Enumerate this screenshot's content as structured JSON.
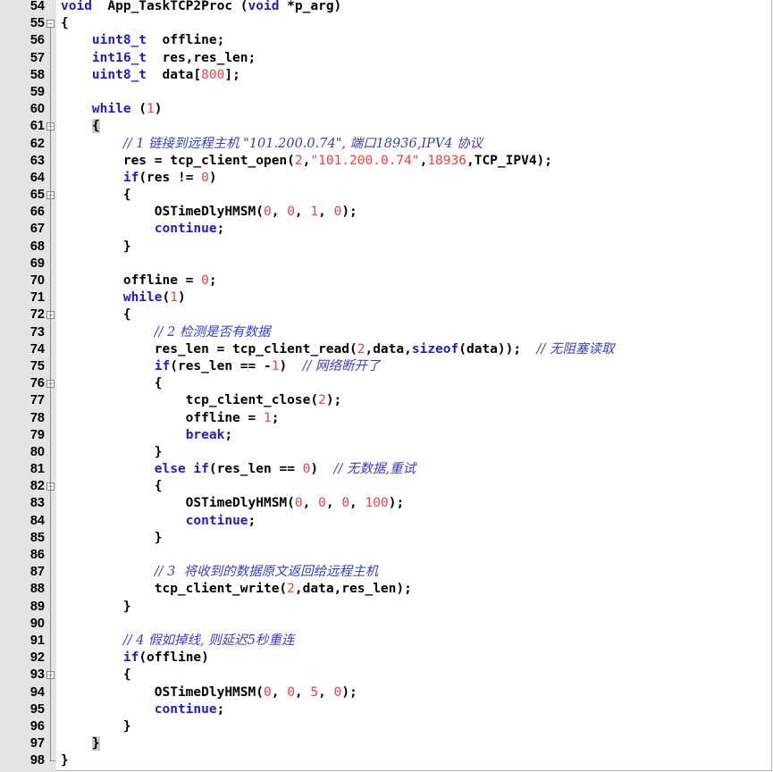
{
  "editor": {
    "lines": [
      {
        "n": "54",
        "html": "<span class='kw'>void</span>  App_TaskTCP2Proc (<span class='kw'>void</span> *p_arg)"
      },
      {
        "n": "55",
        "html": "{"
      },
      {
        "n": "56",
        "html": "    <span class='kw'>uint8_t</span>  offline;"
      },
      {
        "n": "57",
        "html": "    <span class='kw'>int16_t</span>  res,res_len;"
      },
      {
        "n": "58",
        "html": "    <span class='kw'>uint8_t</span>  data[<span class='num-lit'>800</span>];"
      },
      {
        "n": "59",
        "html": ""
      },
      {
        "n": "60",
        "html": "    <span class='kw'>while</span> (<span class='num-lit'>1</span>)"
      },
      {
        "n": "61",
        "html": "    <span class='brace-hl'>{</span>"
      },
      {
        "n": "62",
        "html": "        <span class='cm'>// 1 链接到远程主机 \"101.200.0.74\", 端口18936,IPV4 协议</span>"
      },
      {
        "n": "63",
        "html": "        res = tcp_client_open(<span class='num-lit'>2</span>,<span class='str'>\"101.200.0.74\"</span>,<span class='num-lit'>18936</span>,TCP_IPV4);"
      },
      {
        "n": "64",
        "html": "        <span class='kw'>if</span>(res != <span class='num-lit'>0</span>)"
      },
      {
        "n": "65",
        "html": "        {"
      },
      {
        "n": "66",
        "html": "            OSTimeDlyHMSM(<span class='num-lit'>0</span>, <span class='num-lit'>0</span>, <span class='num-lit'>1</span>, <span class='num-lit'>0</span>);"
      },
      {
        "n": "67",
        "html": "            <span class='kw'>continue</span>;"
      },
      {
        "n": "68",
        "html": "        }"
      },
      {
        "n": "69",
        "html": ""
      },
      {
        "n": "70",
        "html": "        offline = <span class='num-lit'>0</span>;"
      },
      {
        "n": "71",
        "html": "        <span class='kw'>while</span>(<span class='num-lit'>1</span>)"
      },
      {
        "n": "72",
        "html": "        {"
      },
      {
        "n": "73",
        "html": "            <span class='cm'>// 2 检测是否有数据</span>"
      },
      {
        "n": "74",
        "html": "            res_len = tcp_client_read(<span class='num-lit'>2</span>,data,<span class='kw'>sizeof</span>(data));  <span class='cm'>// 无阻塞读取</span>"
      },
      {
        "n": "75",
        "html": "            <span class='kw'>if</span>(res_len == -<span class='num-lit'>1</span>)  <span class='cm'>// 网络断开了</span>"
      },
      {
        "n": "76",
        "html": "            {"
      },
      {
        "n": "77",
        "html": "                tcp_client_close(<span class='num-lit'>2</span>);"
      },
      {
        "n": "78",
        "html": "                offline = <span class='num-lit'>1</span>;"
      },
      {
        "n": "79",
        "html": "                <span class='kw'>break</span>;"
      },
      {
        "n": "80",
        "html": "            }"
      },
      {
        "n": "81",
        "html": "            <span class='kw'>else</span> <span class='kw'>if</span>(res_len == <span class='num-lit'>0</span>)  <span class='cm'>// 无数据,重试</span>"
      },
      {
        "n": "82",
        "html": "            {"
      },
      {
        "n": "83",
        "html": "                OSTimeDlyHMSM(<span class='num-lit'>0</span>, <span class='num-lit'>0</span>, <span class='num-lit'>0</span>, <span class='num-lit'>100</span>);"
      },
      {
        "n": "84",
        "html": "                <span class='kw'>continue</span>;"
      },
      {
        "n": "85",
        "html": "            }"
      },
      {
        "n": "86",
        "html": ""
      },
      {
        "n": "87",
        "html": "            <span class='cm'>// 3  将收到的数据原文返回给远程主机</span>"
      },
      {
        "n": "88",
        "html": "            tcp_client_write(<span class='num-lit'>2</span>,data,res_len);"
      },
      {
        "n": "89",
        "html": "        }"
      },
      {
        "n": "90",
        "html": ""
      },
      {
        "n": "91",
        "html": "        <span class='cm'>// 4 假如掉线, 则延迟5秒重连</span>"
      },
      {
        "n": "92",
        "html": "        <span class='kw'>if</span>(offline)"
      },
      {
        "n": "93",
        "html": "        {"
      },
      {
        "n": "94",
        "html": "            OSTimeDlyHMSM(<span class='num-lit'>0</span>, <span class='num-lit'>0</span>, <span class='num-lit'>5</span>, <span class='num-lit'>0</span>);"
      },
      {
        "n": "95",
        "html": "            <span class='kw'>continue</span>;"
      },
      {
        "n": "96",
        "html": "        }"
      },
      {
        "n": "97",
        "html": "    <span class='brace-hl'>}</span>"
      },
      {
        "n": "98",
        "html": "}"
      }
    ],
    "fold_markers": [
      "55",
      "61",
      "65",
      "72",
      "76",
      "82",
      "93"
    ]
  }
}
